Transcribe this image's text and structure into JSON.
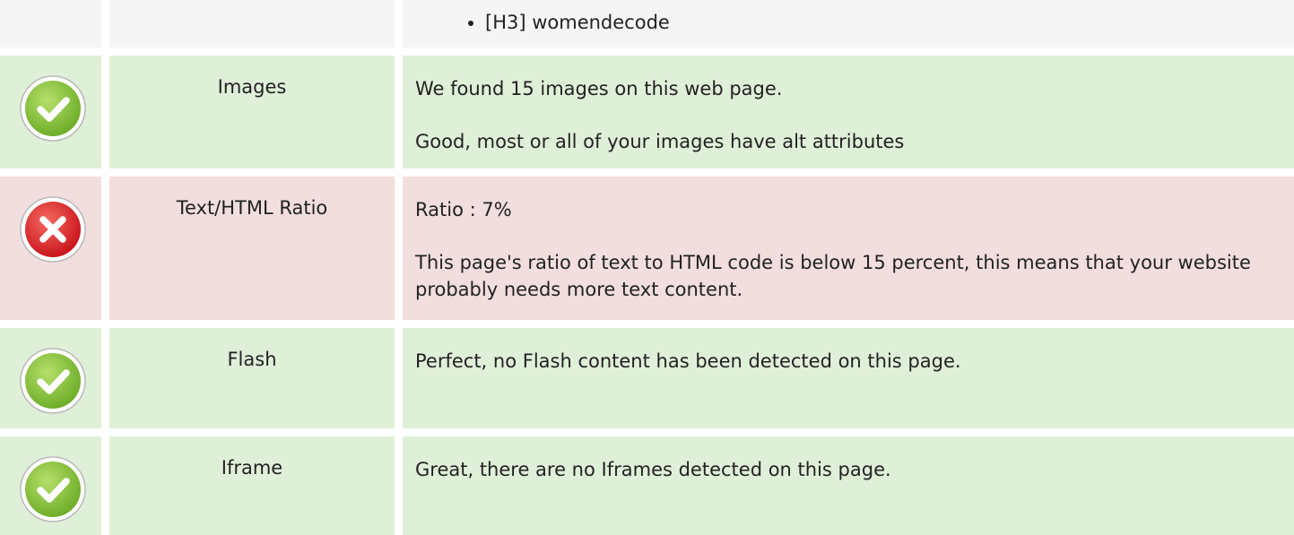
{
  "headings": {
    "items": [
      "[H3] womendecode"
    ]
  },
  "checks": [
    {
      "name": "Images",
      "status": "pass",
      "icon": "check-icon",
      "lines": [
        "We found 15 images on this web page.",
        "Good, most or all of your images have alt attributes"
      ]
    },
    {
      "name": "Text/HTML Ratio",
      "status": "fail",
      "icon": "cross-icon",
      "lines": [
        "Ratio : 7%",
        "This page's ratio of text to HTML code is below 15 percent, this means that your website probably needs more text content."
      ]
    },
    {
      "name": "Flash",
      "status": "pass",
      "icon": "check-icon",
      "lines": [
        "Perfect, no Flash content has been detected on this page."
      ]
    },
    {
      "name": "Iframe",
      "status": "pass",
      "icon": "check-icon",
      "lines": [
        "Great, there are no Iframes detected on this page."
      ]
    }
  ],
  "colors": {
    "pass_bg": "#dff0d8",
    "fail_bg": "#f2dede",
    "neutral_bg": "#f5f5f5",
    "pass_icon": "#8cc63e",
    "fail_icon": "#e0262d"
  }
}
